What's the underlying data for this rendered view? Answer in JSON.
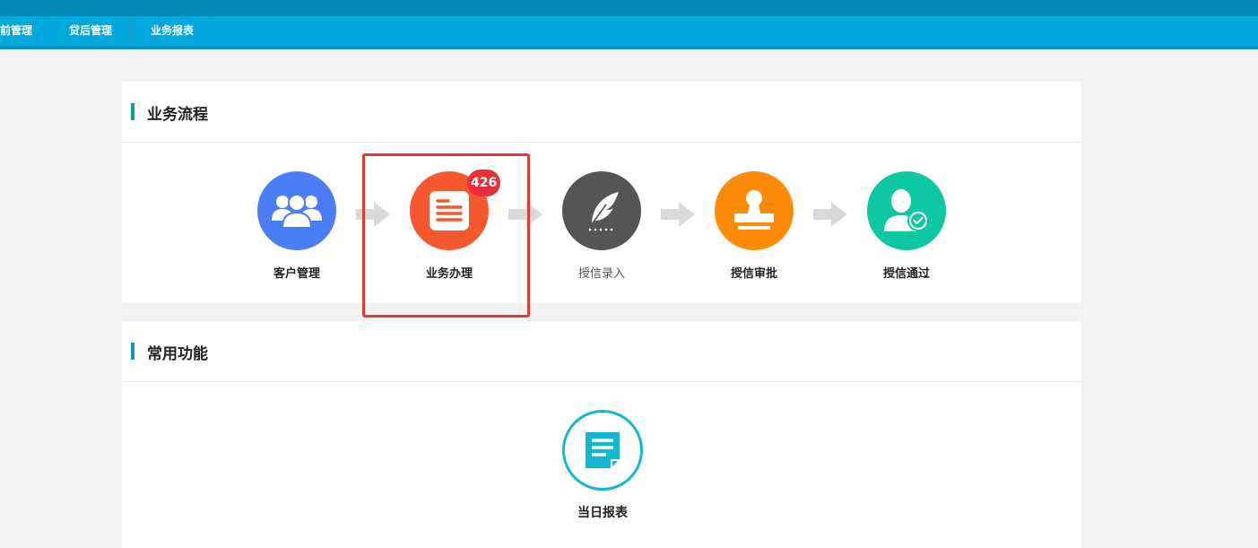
{
  "nav": {
    "items": [
      {
        "label": "前管理"
      },
      {
        "label": "贷后管理"
      },
      {
        "label": "业务报表"
      }
    ]
  },
  "process_panel": {
    "title": "业务流程",
    "steps": [
      {
        "label": "客户管理",
        "icon": "users-icon",
        "color": "#4b7ef5"
      },
      {
        "label": "业务办理",
        "icon": "document-list-icon",
        "color": "#f5572f",
        "badge": "426"
      },
      {
        "label": "授信录入",
        "icon": "quill-icon",
        "color": "#555555"
      },
      {
        "label": "授信审批",
        "icon": "stamp-icon",
        "color": "#fd8a04"
      },
      {
        "label": "授信通过",
        "icon": "user-check-icon",
        "color": "#0dc8a0"
      }
    ]
  },
  "common_panel": {
    "title": "常用功能",
    "items": [
      {
        "label": "当日报表",
        "icon": "report-icon",
        "color": "#13b7cf"
      }
    ]
  }
}
